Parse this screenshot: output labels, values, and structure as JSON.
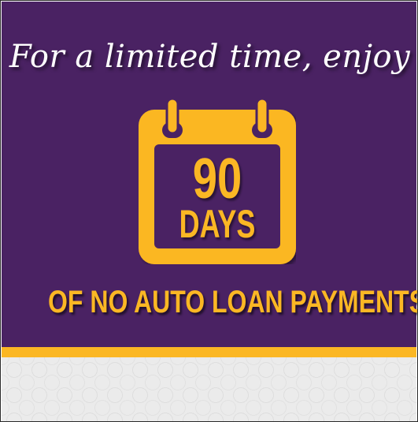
{
  "promo": {
    "headline": "For a limited time, enjoy",
    "calendar_icon": "calendar-icon",
    "number": "90",
    "unit": "DAYS",
    "tagline": "OF NO AUTO LOAN PAYMENTS"
  },
  "colors": {
    "background_purple": "#4a2263",
    "accent_gold": "#fbb724",
    "text_white": "#ffffff",
    "pattern_gray": "#ebebeb"
  }
}
